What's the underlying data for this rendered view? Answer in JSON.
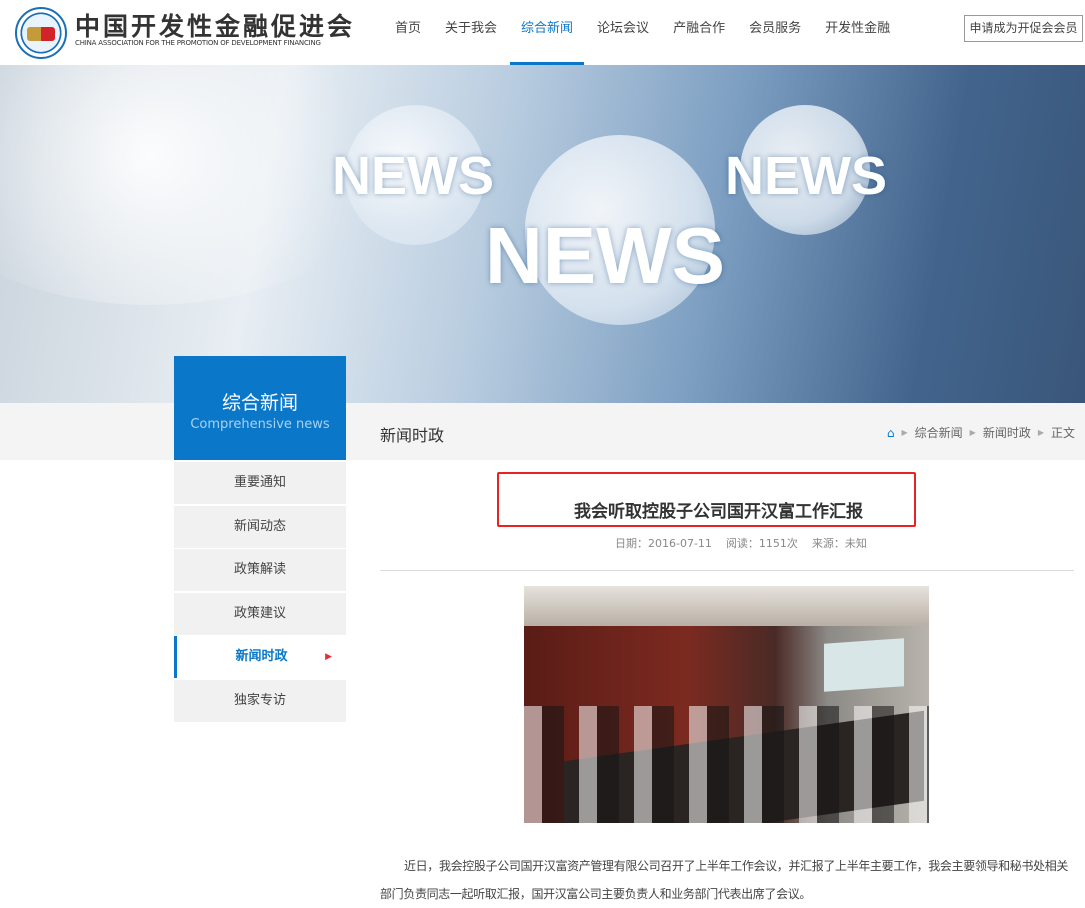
{
  "header": {
    "logo_cn": "中国开发性金融促进会",
    "logo_en": "CHINA ASSOCIATION FOR THE PROMOTION OF DEVELOPMENT FINANCING",
    "nav": [
      {
        "label": "首页"
      },
      {
        "label": "关于我会"
      },
      {
        "label": "综合新闻",
        "active": true
      },
      {
        "label": "论坛会议"
      },
      {
        "label": "产融合作"
      },
      {
        "label": "会员服务"
      },
      {
        "label": "开发性金融"
      }
    ],
    "join_button": "申请成为开促会会员"
  },
  "banner": {
    "words": [
      "NEWS",
      "NEWS",
      "NEWS"
    ]
  },
  "sidebar": {
    "title_cn": "综合新闻",
    "title_en": "Comprehensive news",
    "items": [
      {
        "label": "重要通知"
      },
      {
        "label": "新闻动态"
      },
      {
        "label": "政策解读"
      },
      {
        "label": "政策建议"
      },
      {
        "label": "新闻时政",
        "active": true
      },
      {
        "label": "独家专访"
      }
    ]
  },
  "section_title": "新闻时政",
  "breadcrumb": [
    "综合新闻",
    "新闻时政",
    "正文"
  ],
  "article": {
    "title": "我会听取控股子公司国开汉富工作汇报",
    "date": "日期：2016-07-11",
    "reads": "阅读：1151次",
    "source": "来源：未知",
    "body": "近日，我会控股子公司国开汉富资产管理有限公司召开了上半年工作会议，并汇报了上半年主要工作，我会主要领导和秘书处相关部门负责同志一起听取汇报，国开汉富公司主要负责人和业务部门代表出席了会议。"
  },
  "colors": {
    "accent": "#0a77c9",
    "highlight_box": "#e82323"
  }
}
